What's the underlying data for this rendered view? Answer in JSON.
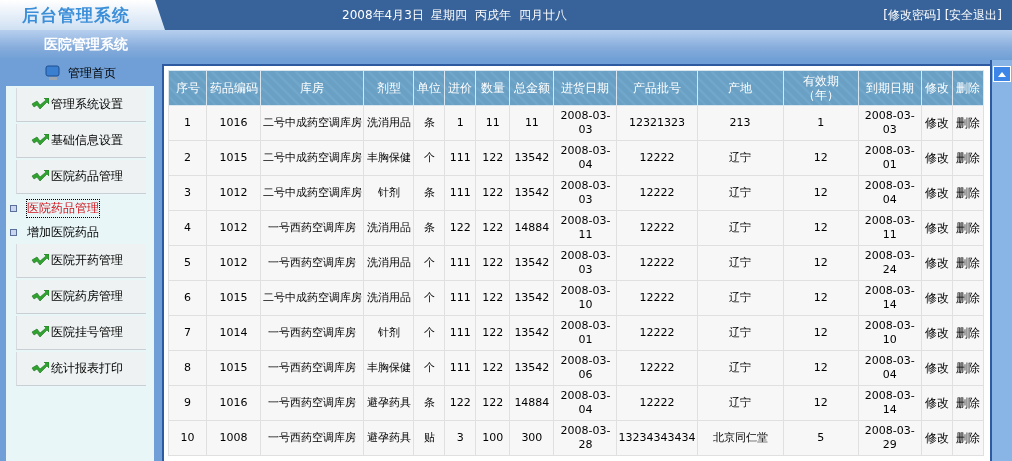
{
  "header": {
    "logo": "后台管理系统",
    "date": "2008年4月3日  星期四  丙戌年  四月廿八",
    "links": [
      "[修改密码]",
      "[安全退出]"
    ]
  },
  "subheader": {
    "title": "医院管理系统"
  },
  "sidebar": {
    "home": "管理首页",
    "items": [
      {
        "kind": "group",
        "label": "管理系统设置"
      },
      {
        "kind": "group",
        "label": "基础信息设置"
      },
      {
        "kind": "group",
        "label": "医院药品管理"
      },
      {
        "kind": "link",
        "label": "医院药品管理",
        "selected": true
      },
      {
        "kind": "link",
        "label": "增加医院药品",
        "selected": false
      },
      {
        "kind": "group",
        "label": "医院开药管理"
      },
      {
        "kind": "group",
        "label": "医院药房管理"
      },
      {
        "kind": "group",
        "label": "医院挂号管理"
      },
      {
        "kind": "group",
        "label": "统计报表打印"
      }
    ]
  },
  "table": {
    "columns": [
      "序号",
      "药品编码",
      "库房",
      "剂型",
      "单位",
      "进价",
      "数量",
      "总金额",
      "进货日期",
      "产品批号",
      "产地",
      "有效期（年）",
      "到期日期",
      "修改",
      "删除"
    ],
    "rows": [
      [
        "1",
        "1016",
        "二号中成药空调库房",
        "洗消用品",
        "条",
        "1",
        "11",
        "11",
        "2008-03-03",
        "12321323",
        "213",
        "1",
        "2008-03-03",
        "修改",
        "删除"
      ],
      [
        "2",
        "1015",
        "二号中成药空调库房",
        "丰胸保健",
        "个",
        "111",
        "122",
        "13542",
        "2008-03-04",
        "12222",
        "辽宁",
        "12",
        "2008-03-01",
        "修改",
        "删除"
      ],
      [
        "3",
        "1012",
        "二号中成药空调库房",
        "针剂",
        "条",
        "111",
        "122",
        "13542",
        "2008-03-03",
        "12222",
        "辽宁",
        "12",
        "2008-03-04",
        "修改",
        "删除"
      ],
      [
        "4",
        "1012",
        "一号西药空调库房",
        "洗消用品",
        "条",
        "122",
        "122",
        "14884",
        "2008-03-11",
        "12222",
        "辽宁",
        "12",
        "2008-03-11",
        "修改",
        "删除"
      ],
      [
        "5",
        "1012",
        "一号西药空调库房",
        "洗消用品",
        "个",
        "111",
        "122",
        "13542",
        "2008-03-03",
        "12222",
        "辽宁",
        "12",
        "2008-03-24",
        "修改",
        "删除"
      ],
      [
        "6",
        "1015",
        "二号中成药空调库房",
        "洗消用品",
        "个",
        "111",
        "122",
        "13542",
        "2008-03-10",
        "12222",
        "辽宁",
        "12",
        "2008-03-14",
        "修改",
        "删除"
      ],
      [
        "7",
        "1014",
        "一号西药空调库房",
        "针剂",
        "个",
        "111",
        "122",
        "13542",
        "2008-03-01",
        "12222",
        "辽宁",
        "12",
        "2008-03-10",
        "修改",
        "删除"
      ],
      [
        "8",
        "1015",
        "一号西药空调库房",
        "丰胸保健",
        "个",
        "111",
        "122",
        "13542",
        "2008-03-06",
        "12222",
        "辽宁",
        "12",
        "2008-03-04",
        "修改",
        "删除"
      ],
      [
        "9",
        "1016",
        "一号西药空调库房",
        "避孕药具",
        "条",
        "122",
        "122",
        "14884",
        "2008-03-04",
        "12222",
        "辽宁",
        "12",
        "2008-03-14",
        "修改",
        "删除"
      ],
      [
        "10",
        "1008",
        "一号西药空调库房",
        "避孕药具",
        "贴",
        "3",
        "100",
        "300",
        "2008-03-28",
        "13234343434",
        "北京同仁堂",
        "5",
        "2008-03-29",
        "修改",
        "删除"
      ]
    ]
  }
}
